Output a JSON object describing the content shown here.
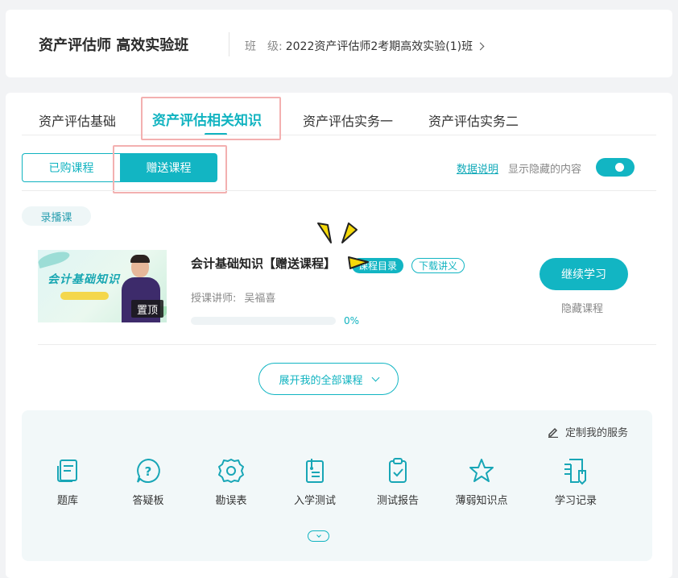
{
  "header": {
    "program_title": "资产评估师 高效实验班",
    "class_label": "班　级:",
    "class_value": "2022资产评估师2考期高效实验(1)班"
  },
  "tabs": [
    {
      "label": "资产评估基础",
      "active": false
    },
    {
      "label": "资产评估相关知识",
      "active": true
    },
    {
      "label": "资产评估实务一",
      "active": false
    },
    {
      "label": "资产评估实务二",
      "active": false
    }
  ],
  "filters": {
    "purchased_label": "已购课程",
    "gift_label": "赠送课程",
    "data_link": "数据说明",
    "show_hidden_label": "显示隐藏的内容",
    "show_hidden_on": true
  },
  "category_tag": "录播课",
  "course": {
    "thumb_title": "会计基础知识",
    "pin_label": "置顶",
    "title": "会计基础知识【赠送课程】",
    "catalog_btn": "课程目录",
    "download_btn": "下载讲义",
    "teacher_label": "授课讲师:",
    "teacher_name": "吴福喜",
    "progress": 0,
    "progress_text": "0%",
    "continue_btn": "继续学习",
    "hide_btn": "隐藏课程"
  },
  "expand_btn": "展开我的全部课程",
  "services": {
    "customize_label": "定制我的服务",
    "items": [
      {
        "label": "题库",
        "icon": "question-bank-icon"
      },
      {
        "label": "答疑板",
        "icon": "question-icon"
      },
      {
        "label": "勘误表",
        "icon": "gear-icon"
      },
      {
        "label": "入学测试",
        "icon": "entrance-test-icon"
      },
      {
        "label": "测试报告",
        "icon": "clipboard-check-icon"
      },
      {
        "label": "薄弱知识点",
        "icon": "star-icon"
      },
      {
        "label": "学习记录",
        "icon": "record-icon"
      }
    ]
  },
  "colors": {
    "accent": "#12b5c3",
    "highlight_box": "#f3b0b0"
  }
}
